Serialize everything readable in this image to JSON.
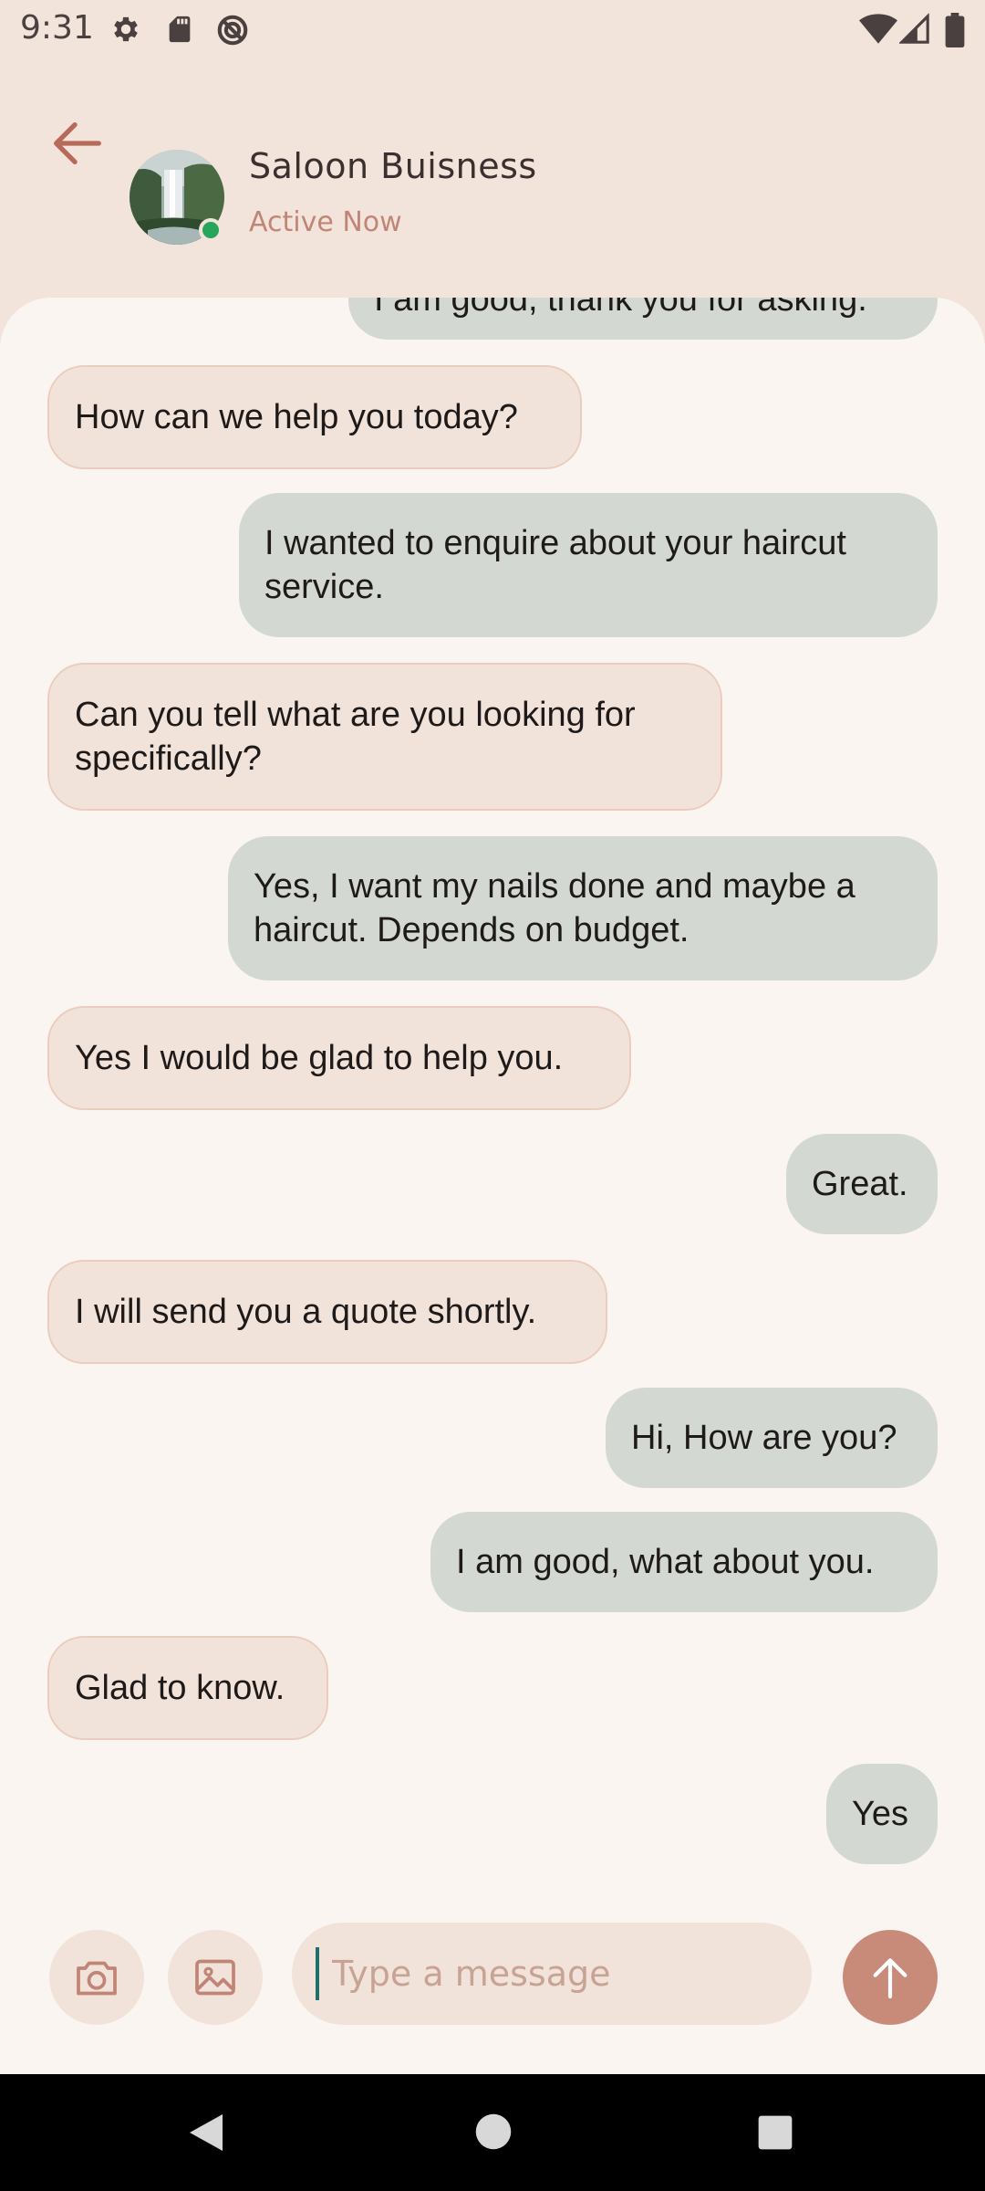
{
  "status_bar": {
    "time": "9:31",
    "left_icons": [
      "settings-icon",
      "sd-card-icon",
      "data-saver-icon"
    ],
    "right_icons": [
      "wifi-icon",
      "cell-signal-icon",
      "battery-icon"
    ]
  },
  "header": {
    "back_icon": "arrow-left-icon",
    "contact_name": "Saloon Buisness",
    "contact_status": "Active Now",
    "online_color": "#27a55a"
  },
  "messages": [
    {
      "side": "sent",
      "text": "I am good, thank you for asking."
    },
    {
      "side": "received",
      "text": "How can we help you today?"
    },
    {
      "side": "sent",
      "text": "I wanted to enquire about your haircut service."
    },
    {
      "side": "received",
      "text": "Can you tell what are you looking for specifically?"
    },
    {
      "side": "sent",
      "text": "Yes, I want my nails done and maybe a haircut. Depends on budget."
    },
    {
      "side": "received",
      "text": "Yes I would be glad to help you."
    },
    {
      "side": "sent",
      "text": "Great."
    },
    {
      "side": "received",
      "text": "I will send you a quote shortly."
    },
    {
      "side": "sent",
      "text": "Hi, How are you?"
    },
    {
      "side": "sent",
      "text": "I am good, what about you."
    },
    {
      "side": "received",
      "text": "Glad to know."
    },
    {
      "side": "sent",
      "text": "Yes"
    }
  ],
  "input": {
    "placeholder": "Type a message",
    "value": "",
    "camera_icon": "camera-icon",
    "gallery_icon": "image-icon",
    "send_icon": "arrow-up-icon"
  },
  "colors": {
    "accent": "#c98b79",
    "received_bubble": "#f2e3da",
    "sent_bubble": "#d4d8d2",
    "header_bg": "#f2e4da",
    "chat_bg": "#faf5f1"
  }
}
